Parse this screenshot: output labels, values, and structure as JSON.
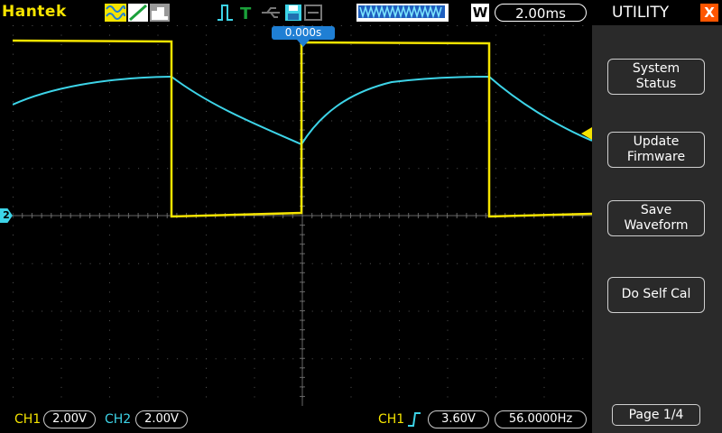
{
  "brand": "Hantek",
  "timebase": "2.00ms",
  "mode_letter": "W",
  "trigger_time": "0.000s",
  "ch2_marker": "2",
  "bottom": {
    "ch1_label": "CH1",
    "ch1_scale": "2.00V",
    "ch2_label": "CH2",
    "ch2_scale": "2.00V",
    "trig_source": "CH1",
    "trig_level": "3.60V",
    "frequency": "56.0000Hz"
  },
  "side_panel": {
    "title": "UTILITY",
    "buttons": [
      {
        "line1": "System",
        "line2": "Status"
      },
      {
        "line1": "Update",
        "line2": "Firmware"
      },
      {
        "line1": "Save",
        "line2": "Waveform"
      },
      {
        "line1": "Do Self Cal",
        "line2": ""
      }
    ],
    "page": "Page 1/4"
  },
  "colors": {
    "ch1": "#f5e400",
    "ch2": "#3dd4e8",
    "accent": "#1f7fd4",
    "close": "#ff5500"
  },
  "icons": [
    "waveform-type-icon",
    "ramp-icon",
    "stack-icon",
    "pulse-trigger-icon",
    "t-trigger-icon",
    "usb-icon",
    "save-disk-icon",
    "printer-icon"
  ]
}
